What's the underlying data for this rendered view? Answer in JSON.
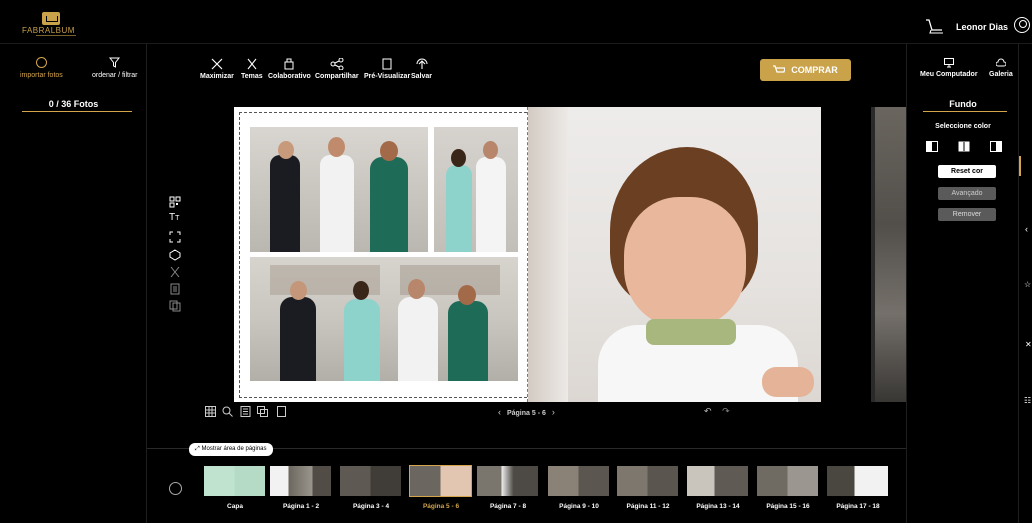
{
  "brand": {
    "logo_text": "FABRALBUM"
  },
  "header": {
    "user_name": "Leonor Dias"
  },
  "left_panel": {
    "import_label": "importar fotos",
    "order_label": "ordenar / filtrar",
    "photo_count": "0 / 36 Fotos"
  },
  "toolbar": {
    "items": [
      "Maximizar",
      "Temas",
      "Colaborativo",
      "Compartilhar",
      "Pré-Visualizar",
      "Salvar"
    ],
    "buy_label": "COMPRAR"
  },
  "canvas": {
    "page_nav_label": "Página 5 - 6"
  },
  "right_panel": {
    "tab_computer": "Meu Computador",
    "tab_gallery": "Galeria",
    "section_title": "Fundo",
    "select_color_label": "Seleccione color",
    "reset_color_label": "Reset cor",
    "advanced_label": "Avançado",
    "remove_label": "Remover"
  },
  "strip": {
    "show_area_label": "Mostrar área de páginas",
    "pages": [
      "Capa",
      "Página 1 - 2",
      "Página 3 - 4",
      "Página 5 - 6",
      "Página 7 - 8",
      "Página 9 - 10",
      "Página 11 - 12",
      "Página 13 - 14",
      "Página 15 - 16",
      "Página 17 - 18"
    ],
    "active_page": "Página 5 - 6"
  },
  "colors": {
    "accent_gold": "#c9a24a",
    "background": "#000000",
    "active_label": "#d4a54d"
  }
}
